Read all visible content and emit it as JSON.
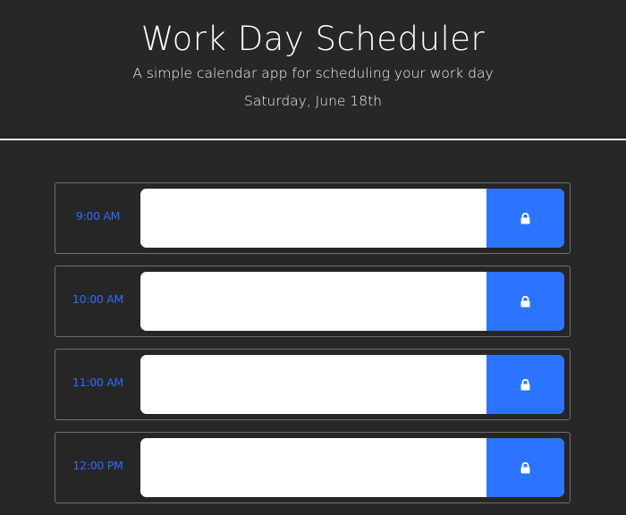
{
  "header": {
    "title": "Work Day Scheduler",
    "subtitle": "A simple calendar app for scheduling your work day",
    "date": "Saturday, June 18th"
  },
  "colors": {
    "background": "#272727",
    "hour_text": "#2f6bff",
    "save_button": "#2a74ff",
    "entry_background": "#ffffff"
  },
  "time_blocks": [
    {
      "hour": "9:00 AM",
      "entry": "",
      "save_icon": "lock-icon"
    },
    {
      "hour": "10:00 AM",
      "entry": "",
      "save_icon": "lock-icon"
    },
    {
      "hour": "11:00 AM",
      "entry": "",
      "save_icon": "lock-icon"
    },
    {
      "hour": "12:00 PM",
      "entry": "",
      "save_icon": "lock-icon"
    }
  ]
}
